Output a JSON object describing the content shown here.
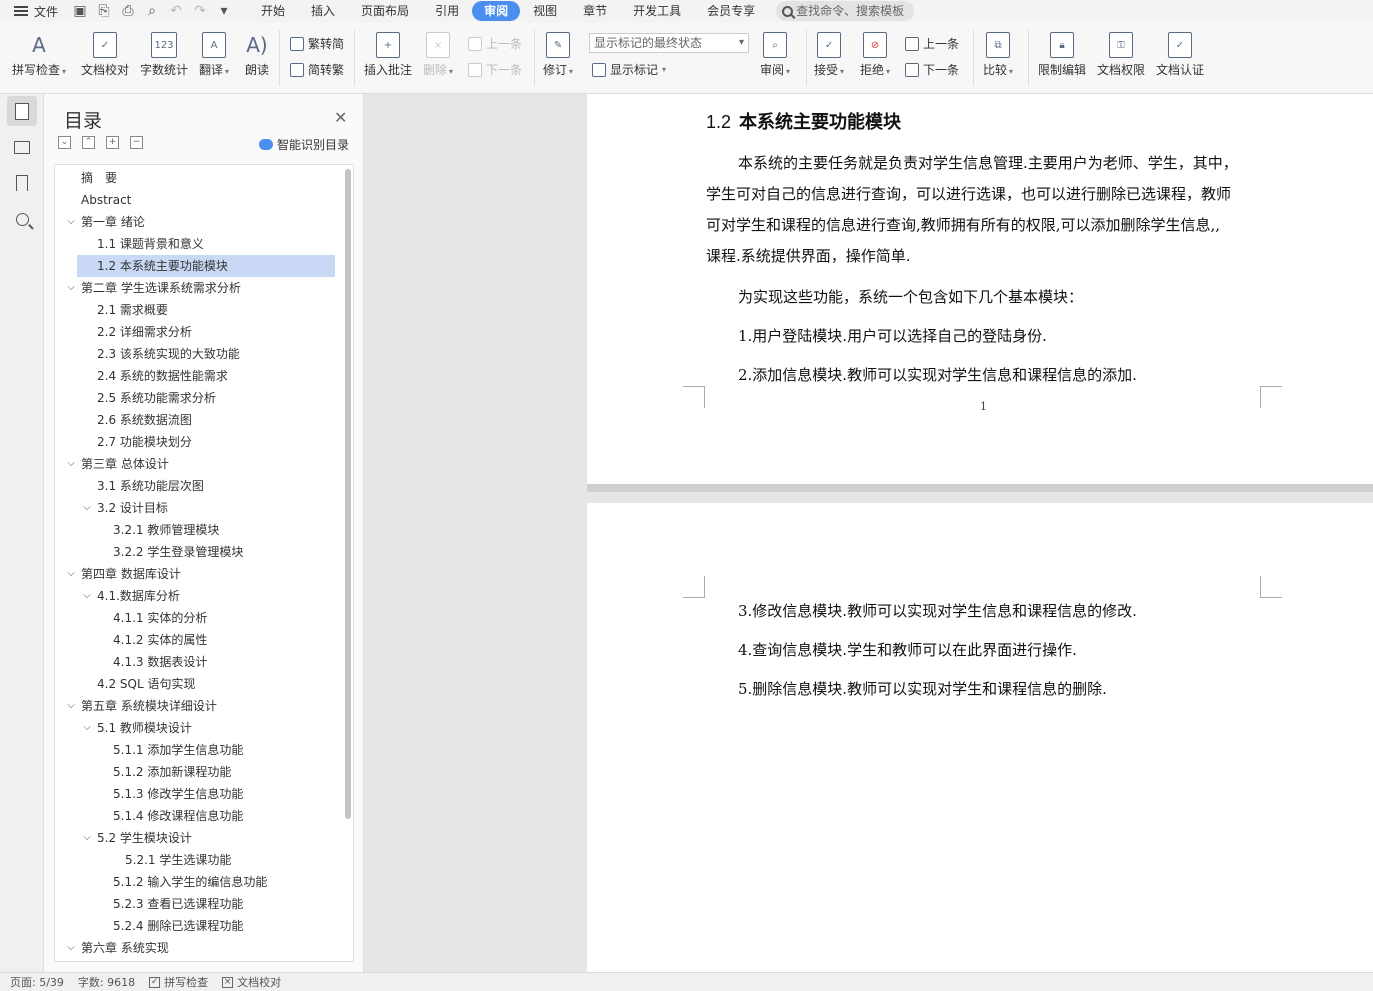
{
  "menubar": {
    "file_label": "文件",
    "tabs": [
      "开始",
      "插入",
      "页面布局",
      "引用",
      "审阅",
      "视图",
      "章节",
      "开发工具",
      "会员专享"
    ],
    "active_tab": "审阅",
    "search_placeholder": "查找命令、搜索模板"
  },
  "ribbon": {
    "spell_check": "拼写检查",
    "doc_proof": "文档校对",
    "word_count": "字数统计",
    "translate": "翻译",
    "read_aloud": "朗读",
    "to_traditional": "繁转简",
    "to_simplified": "简转繁",
    "insert_comment": "插入批注",
    "delete": "删除",
    "prev_comment": "上一条",
    "next_comment": "下一条",
    "track_changes": "修订",
    "markup_state": "显示标记的最终状态",
    "show_markup": "显示标记",
    "review": "审阅",
    "accept": "接受",
    "reject": "拒绝",
    "prev_change": "上一条",
    "next_change": "下一条",
    "compare": "比较",
    "restrict_edit": "限制编辑",
    "doc_rights": "文档权限",
    "doc_auth": "文档认证"
  },
  "toc": {
    "title": "目录",
    "smart_detect": "智能识别目录",
    "items": [
      {
        "text": "摘　要",
        "level": 1,
        "chev": false
      },
      {
        "text": "Abstract",
        "level": 1,
        "chev": false
      },
      {
        "text": "第一章  绪论",
        "level": 1,
        "chev": true
      },
      {
        "text": "1.1  课题背景和意义",
        "level": 2,
        "chev": false
      },
      {
        "text": "1.2  本系统主要功能模块",
        "level": 2,
        "chev": false,
        "selected": true
      },
      {
        "text": "第二章  学生选课系统需求分析",
        "level": 1,
        "chev": true
      },
      {
        "text": "2.1 需求概要",
        "level": 2,
        "chev": false
      },
      {
        "text": "2.2 详细需求分析",
        "level": 2,
        "chev": false
      },
      {
        "text": "2.3 该系统实现的大致功能",
        "level": 2,
        "chev": false
      },
      {
        "text": "2.4 系统的数据性能需求",
        "level": 2,
        "chev": false
      },
      {
        "text": "2.5 系统功能需求分析",
        "level": 2,
        "chev": false
      },
      {
        "text": "2.6 系统数据流图",
        "level": 2,
        "chev": false
      },
      {
        "text": "2.7  功能模块划分",
        "level": 2,
        "chev": false
      },
      {
        "text": "第三章    总体设计",
        "level": 1,
        "chev": true
      },
      {
        "text": "3.1 系统功能层次图",
        "level": 2,
        "chev": false
      },
      {
        "text": "3.2 设计目标",
        "level": 2,
        "chev": true
      },
      {
        "text": "3.2.1 教师管理模块",
        "level": 3,
        "chev": false
      },
      {
        "text": "3.2.2 学生登录管理模块",
        "level": 3,
        "chev": false
      },
      {
        "text": "第四章    数据库设计",
        "level": 1,
        "chev": true
      },
      {
        "text": "4.1.数据库分析",
        "level": 2,
        "chev": true
      },
      {
        "text": "4.1.1 实体的分析",
        "level": 3,
        "chev": false
      },
      {
        "text": "4.1.2 实体的属性",
        "level": 3,
        "chev": false
      },
      {
        "text": "4.1.3 数据表设计",
        "level": 3,
        "chev": false
      },
      {
        "text": "4.2 SQL 语句实现",
        "level": 2,
        "chev": false
      },
      {
        "text": "第五章    系统模块详细设计",
        "level": 1,
        "chev": true
      },
      {
        "text": "5.1 教师模块设计",
        "level": 2,
        "chev": true
      },
      {
        "text": "5.1.1 添加学生信息功能",
        "level": 3,
        "chev": false
      },
      {
        "text": "5.1.2 添加新课程功能",
        "level": 3,
        "chev": false
      },
      {
        "text": "5.1.3 修改学生信息功能",
        "level": 3,
        "chev": false
      },
      {
        "text": "5.1.4 修改课程信息功能",
        "level": 3,
        "chev": false
      },
      {
        "text": "5.2 学生模块设计",
        "level": 2,
        "chev": true
      },
      {
        "text": "5.2.1 学生选课功能",
        "level": 4,
        "chev": false
      },
      {
        "text": "5.1.2 输入学生的编信息功能",
        "level": 3,
        "chev": false
      },
      {
        "text": "5.2.3 查看已选课程功能",
        "level": 3,
        "chev": false
      },
      {
        "text": "5.2.4 删除已选课程功能",
        "level": 3,
        "chev": false
      },
      {
        "text": "第六章    系统实现",
        "level": 1,
        "chev": true
      }
    ]
  },
  "document": {
    "heading_num": "1.2",
    "heading_text": "本系统主要功能模块",
    "para1": [
      "本系统的主要任务就是负责对学生信息管理.主要用户为老师、学生，其中，",
      "学生可对自己的信息进行查询，可以进行选课，也可以进行删除已选课程，教师",
      "可对学生和课程的信息进行查询,教师拥有所有的权限,可以添加删除学生信息,,",
      "课程.系统提供界面，操作简单."
    ],
    "para2": "为实现这些功能，系统一个包含如下几个基本模块：",
    "items_page1": [
      "1.用户登陆模块.用户可以选择自己的登陆身份.",
      "2.添加信息模块.教师可以实现对学生信息和课程信息的添加."
    ],
    "page_number": "1",
    "items_page2": [
      "3.修改信息模块.教师可以实现对学生信息和课程信息的修改.",
      "4.查询信息模块.学生和教师可以在此界面进行操作.",
      "5.删除信息模块.教师可以实现对学生和课程信息的删除."
    ]
  },
  "status": {
    "page": "页面: 5/39",
    "words": "字数: 9618",
    "spell": "拼写检查",
    "proof": "文档校对"
  }
}
